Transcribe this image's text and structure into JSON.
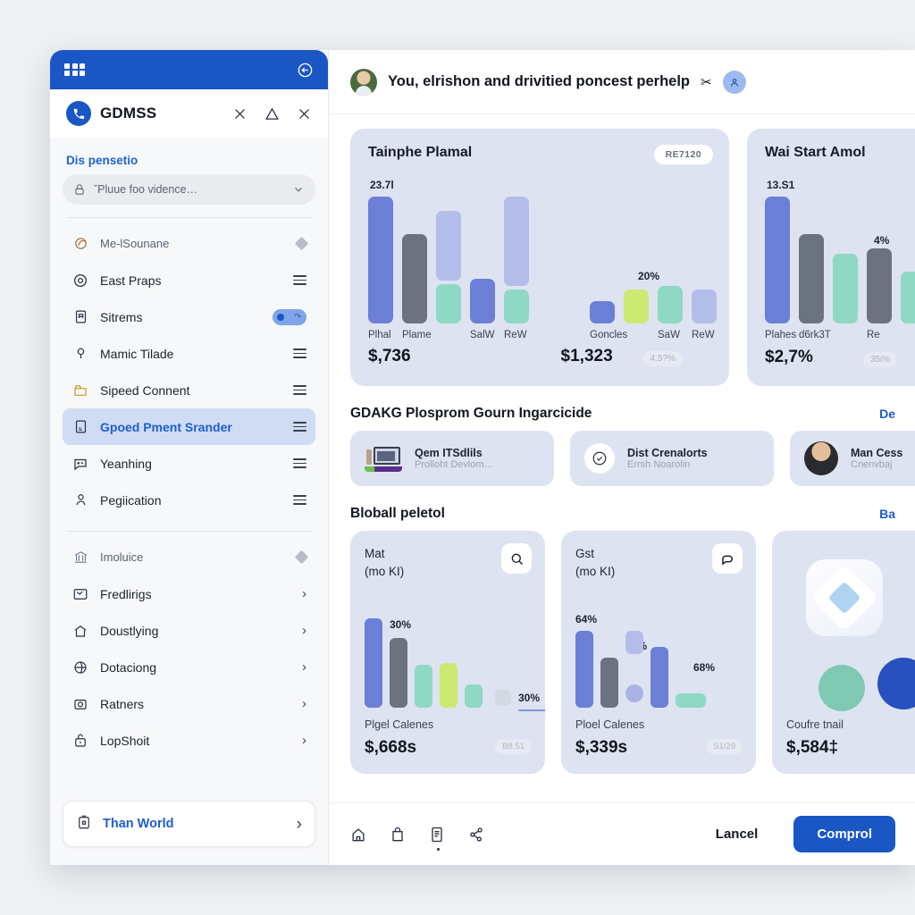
{
  "sidebar": {
    "topbar": {
      "grid_icon": "grid-icon",
      "sync_icon": "sync-icon"
    },
    "brand": {
      "name": "GDMSS",
      "logo_icon": "phone-circle-icon",
      "actions": [
        {
          "name": "close-icon",
          "glyph": "✕"
        },
        {
          "name": "warning-triangle-icon",
          "glyph": "⚠"
        },
        {
          "name": "close-icon",
          "glyph": "✕"
        }
      ]
    },
    "section_title": "Dis pensetio",
    "select": {
      "value": "ˇPluue foo vidence…",
      "lock_icon": "lock-icon",
      "chevron_icon": "chevron-down-icon"
    },
    "items_primary": [
      {
        "label": "Me-lSounane",
        "icon": "chrome-circle-icon",
        "trail": "diamond",
        "muted": true,
        "active": false
      },
      {
        "label": "East Praps",
        "icon": "target-circle-icon",
        "trail": "hamburger",
        "muted": false,
        "active": false
      },
      {
        "label": "Sitrems",
        "icon": "book-icon",
        "trail": "toggle",
        "muted": false,
        "active": false
      },
      {
        "label": "Mamic Tilade",
        "icon": "pin-icon",
        "trail": "hamburger",
        "muted": false,
        "active": false
      },
      {
        "label": "Sipeed Connent",
        "icon": "folder-icon",
        "trail": "hamburger",
        "muted": false,
        "active": false
      },
      {
        "label": "Gpoed Pment Srander",
        "icon": "id-card-icon",
        "trail": "hamburger",
        "muted": false,
        "active": true
      },
      {
        "label": "Yeanhing",
        "icon": "chat-icon",
        "trail": "hamburger",
        "muted": false,
        "active": false
      },
      {
        "label": "Pegiication",
        "icon": "user-icon",
        "trail": "hamburger",
        "muted": false,
        "active": false
      }
    ],
    "items_secondary": [
      {
        "label": "Imoluice",
        "icon": "bank-icon",
        "trail": "diamond",
        "muted": true
      },
      {
        "label": "Fredlirigs",
        "icon": "mail-check-icon",
        "trail": "chevron"
      },
      {
        "label": "Doustlying",
        "icon": "home-icon",
        "trail": "chevron"
      },
      {
        "label": "Dotaciong",
        "icon": "globe-icon",
        "trail": "chevron"
      },
      {
        "label": "Ratners",
        "icon": "camera-icon",
        "trail": "chevron"
      },
      {
        "label": "LopShoit",
        "icon": "lock-box-icon",
        "trail": "chevron"
      }
    ],
    "cta": {
      "label": "Than World",
      "icon": "lock-doc-icon",
      "chevron_icon": "chevron-right-icon"
    }
  },
  "header": {
    "avatar": "user-avatar",
    "title": "You, elrishon and drivitied poncest perhelp",
    "scissors_icon": "scissors-icon",
    "chip_icon": "profile-chip-icon"
  },
  "charts": {
    "card1": {
      "title": "Tainphe Plamal",
      "badge": "RE7120",
      "group_a": {
        "value": "$,736",
        "top_label": "23.7l"
      },
      "group_b": {
        "value": "$1,323",
        "top_label": "20%",
        "pill": "4.5?%"
      }
    },
    "card2": {
      "title": "Wai Start Amol",
      "value": "$2,7%",
      "top_label": "13.S1",
      "mid_label": "4%",
      "pill": "35i%"
    }
  },
  "chart_data": [
    {
      "type": "bar",
      "title": "Tainphe Plamal",
      "subcharts": [
        {
          "name": "group-a",
          "categories": [
            "Plhal",
            "Plame",
            "",
            "SalW",
            "ReW"
          ],
          "values": [
            100,
            68,
            62,
            34,
            92
          ],
          "bases": [
            0,
            0,
            28,
            0,
            22
          ],
          "colors": [
            "#6b7fd7",
            "#6b7280",
            "#b4bdea",
            "#6b7fd7",
            "#8ed8c4"
          ],
          "extra_bars": [
            {
              "after": 2,
              "value": 28,
              "base": 0,
              "color": "#8ed8c4"
            },
            {
              "after": 4,
              "value": 22,
              "base": 0,
              "color": "#8ed8c4"
            }
          ],
          "data_label": "23.7l",
          "total": "$,736"
        },
        {
          "name": "group-b",
          "categories": [
            "Goncles",
            "",
            "SaW",
            "ReW"
          ],
          "values": [
            22,
            30,
            34,
            30
          ],
          "colors": [
            "#6b7fd7",
            "#ccea70",
            "#8ed8c4",
            "#b4bdea"
          ],
          "data_label": "20%",
          "total": "$1,323",
          "pill": "4.5?%"
        }
      ],
      "ylabel": "",
      "xlabel": "",
      "grid": false,
      "legend": false
    },
    {
      "type": "bar",
      "title": "Wai Start Amol",
      "categories": [
        "Plahes",
        "d6rk3T",
        "",
        "Re"
      ],
      "values": [
        100,
        68,
        48,
        50
      ],
      "colors": [
        "#6b7fd7",
        "#6b7280",
        "#8ed8c4",
        "#6b7280"
      ],
      "data_labels": [
        "13.S1",
        "",
        "4%",
        ""
      ],
      "total": "$2,7%",
      "pill": "35i%",
      "grid": false,
      "legend": false
    },
    {
      "type": "bar",
      "title": "Mat (mo KI)",
      "categories": [
        "",
        "",
        "",
        "",
        ""
      ],
      "values": [
        86,
        68,
        40,
        42,
        22
      ],
      "colors": [
        "#6b7fd7",
        "#6b7280",
        "#8ed8c4",
        "#ccea70",
        "#8ed8c4"
      ],
      "data_labels": [
        "",
        "30%",
        "",
        "",
        ""
      ],
      "annotation": "30%",
      "axis_label": "Plgel Calenes",
      "total": "$,668s",
      "pill": "B8.51",
      "grid": false,
      "legend": false
    },
    {
      "type": "bar",
      "title": "Gst (mo KI)",
      "categories": [
        "",
        "",
        "",
        "",
        ""
      ],
      "values": [
        78,
        52,
        24,
        68,
        16
      ],
      "colors": [
        "#6b7fd7",
        "#6b7280",
        "#b4bdea",
        "#6b7fd7",
        "#8ed8c4"
      ],
      "data_labels": [
        "64%",
        "68%",
        "",
        "",
        "68%"
      ],
      "axis_label": "Ploel Calenes",
      "total": "$,339s",
      "pill": "S1I29",
      "grid": false,
      "legend": false
    }
  ],
  "program_section": {
    "title": "GDAKG Plosprom Gourn Ingarcicide",
    "link": "De",
    "tiles": [
      {
        "t1": "Qem ITSdlils",
        "t2": "Prolloht Devlom…",
        "media": "thumbnail"
      },
      {
        "t1": "Dist Crenalorts",
        "t2": "Errsh Noarolin",
        "media": "circle-icon"
      },
      {
        "t1": "Man Cess",
        "t2": "Cnenvbaj",
        "media": "avatar"
      }
    ]
  },
  "bottom_section": {
    "title": "Bloball peletol",
    "link": "Ba",
    "cards": [
      {
        "title": "Mat\n(mo KI)",
        "btn_icon": "search-icon",
        "axis_label": "Plgel Calenes",
        "value": "$,668s",
        "pill": "B8.51",
        "note": "30%",
        "note2": "30%"
      },
      {
        "title": "Gst\n(mo KI)",
        "btn_icon": "tag-icon",
        "axis_label": "Ploel Calenes",
        "value": "$,339s",
        "pill": "S1I29",
        "note": "64%",
        "note2": "68%",
        "note3": "68%"
      },
      {
        "title": "",
        "axis_label": "Coufre tnail",
        "value": "$,584‡"
      }
    ]
  },
  "footer": {
    "icons": [
      {
        "name": "home-icon"
      },
      {
        "name": "bag-icon"
      },
      {
        "name": "document-icon"
      },
      {
        "name": "share-icon"
      }
    ],
    "cancel_label": "Lancel",
    "confirm_label": "Comprol"
  },
  "colors": {
    "brand_blue": "#1a56c4",
    "link_blue": "#1f5ecb",
    "card_bg": "#dde3f1",
    "bar_periwinkle": "#6b7fd7",
    "bar_gray": "#6b7280",
    "bar_lavender": "#b4bdea",
    "bar_mint": "#8ed8c4",
    "bar_lime": "#ccea70"
  }
}
